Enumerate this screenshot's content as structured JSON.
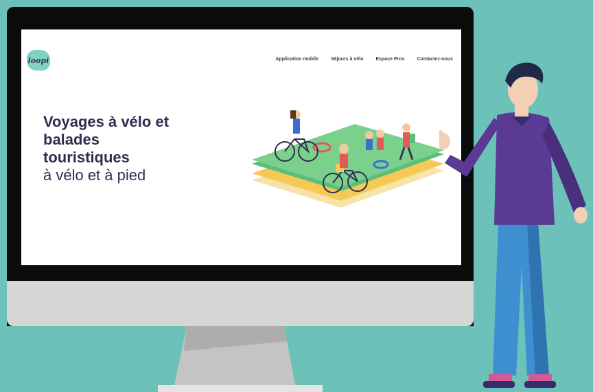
{
  "website": {
    "logo_text": "loopi",
    "nav": [
      "Application mobile",
      "Séjours à vélo",
      "Espace Pros",
      "Contactez-nous"
    ],
    "hero": {
      "title_lines": [
        "Voyages à vélo et",
        "balades",
        "touristiques"
      ],
      "subtitle": "à vélo et à pied"
    }
  },
  "colors": {
    "background": "#6cc1b9",
    "monitor_bezel": "#0b0b0b",
    "monitor_chin": "#d6d6d6",
    "heading": "#2c2f4e",
    "logo_bg": "#7fd3c5",
    "shirt": "#5b3a94",
    "pants": "#3d8fd0"
  },
  "icons": [
    "logo-icon",
    "bicycle-illustration",
    "presenter-person"
  ]
}
